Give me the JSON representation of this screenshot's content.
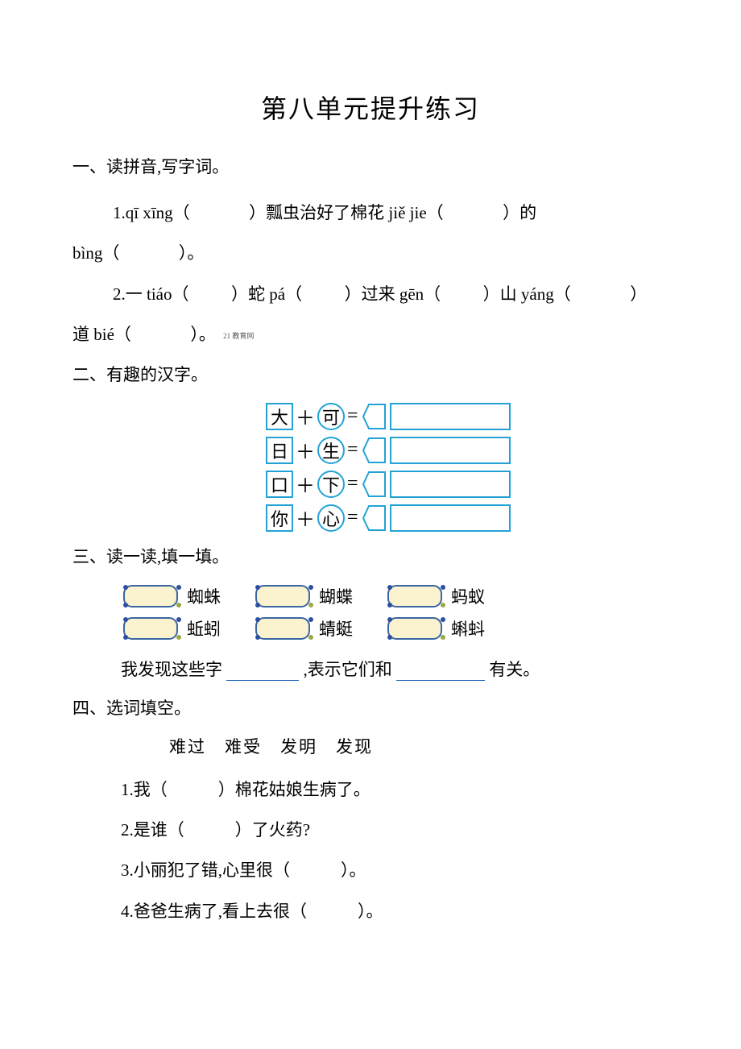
{
  "title": "第八单元提升练习",
  "s1": {
    "header": "一、读拼音,写字词。",
    "q1_a": "1.qī xīng（",
    "q1_b": "）瓢虫治好了棉花 jiě jie（",
    "q1_c": "）的",
    "q1_d": "bìng（",
    "q1_e": "）。",
    "q2_a": "2.一 tiáo（",
    "q2_b": "）蛇 pá（",
    "q2_c": "）过来 gēn（",
    "q2_d": "）山 yáng（",
    "q2_e": "）",
    "q2_f": "道 bié（",
    "q2_g": "）。",
    "tiny": "21 教育网"
  },
  "s2": {
    "header": "二、有趣的汉字。",
    "rows": [
      {
        "left": "大",
        "right": "可"
      },
      {
        "left": "日",
        "right": "生"
      },
      {
        "left": "口",
        "right": "下"
      },
      {
        "left": "你",
        "right": "心"
      }
    ]
  },
  "s3": {
    "header": "三、读一读,填一填。",
    "row1": [
      "蜘蛛",
      "蝴蝶",
      "蚂蚁"
    ],
    "row2": [
      "蚯蚓",
      "蜻蜓",
      "蝌蚪"
    ],
    "fill_a": "我发现这些字",
    "fill_b": ",表示它们和",
    "fill_c": "有关。"
  },
  "s4": {
    "header": "四、选词填空。",
    "bank": "难过　难受　发明　发现",
    "q1": "1.我（　　　）棉花姑娘生病了。",
    "q2": "2.是谁（　　　）了火药?",
    "q3": "3.小丽犯了错,心里很（　　　）。",
    "q4": "4.爸爸生病了,看上去很（　　　）。"
  }
}
